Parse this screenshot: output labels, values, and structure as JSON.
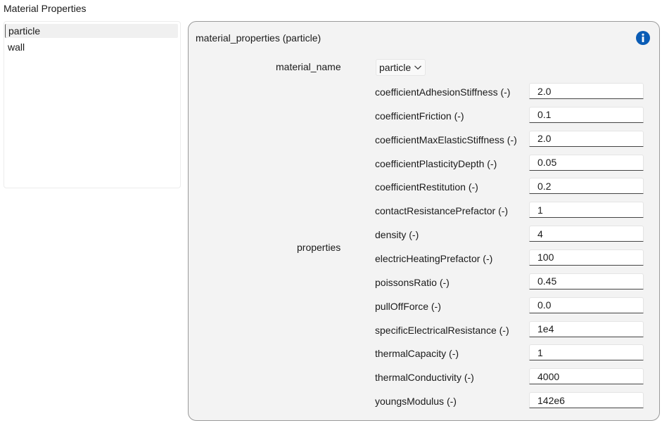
{
  "page_title": "Material Properties",
  "materials": [
    "particle",
    "wall"
  ],
  "panel": {
    "title": "material_properties (particle)",
    "material_name_label": "material_name",
    "material_name_value": "particle",
    "properties_label": "properties",
    "properties": [
      {
        "name": "coefficientAdhesionStiffness (-)",
        "value": "2.0"
      },
      {
        "name": "coefficientFriction (-)",
        "value": "0.1"
      },
      {
        "name": "coefficientMaxElasticStiffness (-)",
        "value": "2.0"
      },
      {
        "name": "coefficientPlasticityDepth (-)",
        "value": "0.05"
      },
      {
        "name": "coefficientRestitution (-)",
        "value": "0.2"
      },
      {
        "name": "contactResistancePrefactor (-)",
        "value": "1"
      },
      {
        "name": "density (-)",
        "value": "4"
      },
      {
        "name": "electricHeatingPrefactor (-)",
        "value": "100"
      },
      {
        "name": "poissonsRatio (-)",
        "value": "0.45"
      },
      {
        "name": "pullOffForce (-)",
        "value": "0.0"
      },
      {
        "name": "specificElectricalResistance (-)",
        "value": "1e4"
      },
      {
        "name": "thermalCapacity (-)",
        "value": "1"
      },
      {
        "name": "thermalConductivity (-)",
        "value": "4000"
      },
      {
        "name": "youngsModulus (-)",
        "value": "142e6"
      }
    ]
  },
  "colors": {
    "accent": "#0a5cb5",
    "panel_bg": "#f3f3f3",
    "panel_border": "#9a9a9a"
  },
  "icons": {
    "info": "info-icon",
    "dropdown": "chevron-down-icon"
  }
}
